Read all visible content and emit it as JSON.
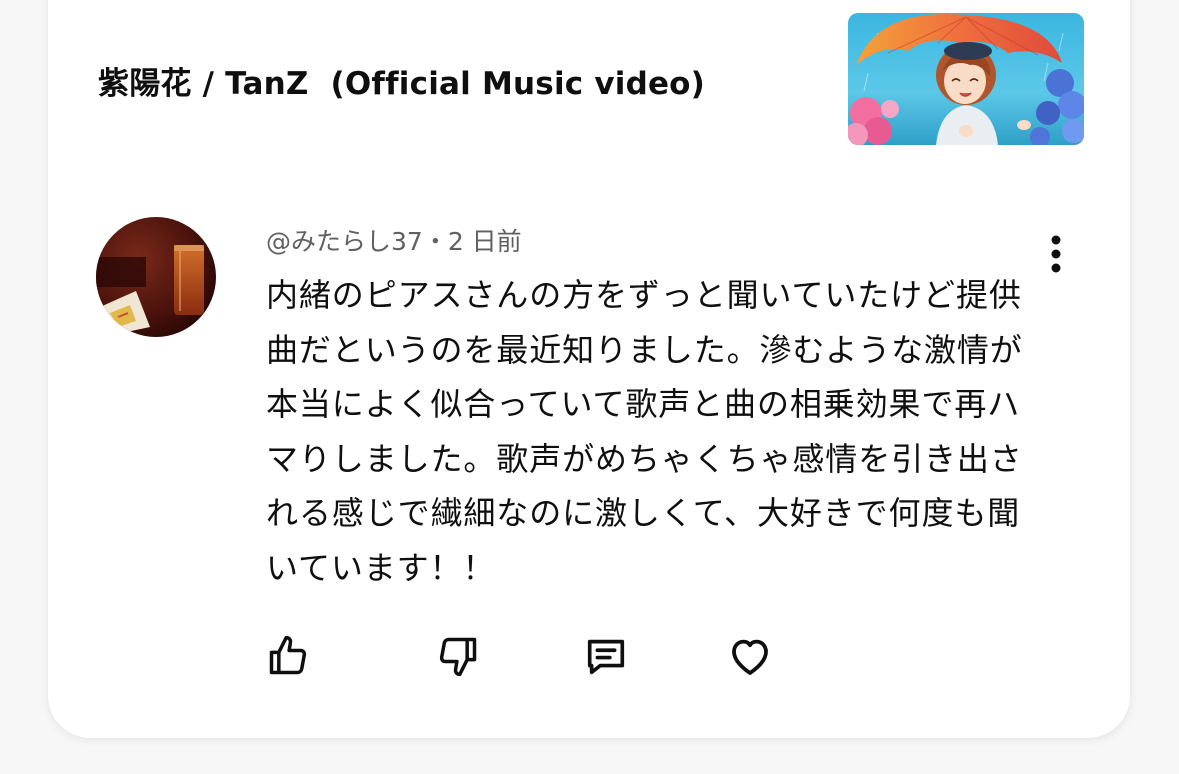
{
  "video": {
    "title": "紫陽花 / TanZ  (Official Music video)",
    "thumbnail_icon": "anime-girl-umbrella-thumbnail"
  },
  "comment": {
    "avatar_icon": "user-avatar",
    "author": "@みたらし37",
    "separator": "・",
    "time": "2 日前",
    "text": "内緒のピアスさんの方をずっと聞いていたけど提供曲だというのを最近知りました。滲むような激情が本当によく似合っていて歌声と曲の相乗効果で再ハマりしました。歌声がめちゃくちゃ感情を引き出される感じで繊細なのに激しくて、大好きで何度も聞いています！！"
  },
  "actions": {
    "like_icon": "thumbs-up-icon",
    "dislike_icon": "thumbs-down-icon",
    "reply_icon": "reply-comment-icon",
    "heart_icon": "heart-icon",
    "more_icon": "more-vertical-icon"
  },
  "colors": {
    "text_primary": "#0f0f0f",
    "text_secondary": "#606060",
    "card_background": "#ffffff",
    "page_background": "#f7f7f7"
  }
}
